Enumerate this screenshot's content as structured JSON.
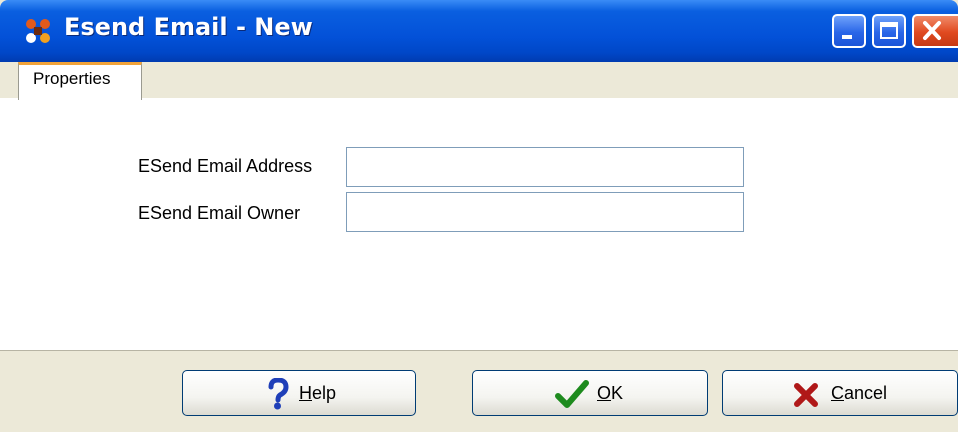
{
  "window": {
    "title": "Esend Email - New",
    "icon": "app-icon"
  },
  "tabs": [
    {
      "label": "Properties",
      "active": true
    }
  ],
  "form": {
    "address_label": "ESend Email Address",
    "address_value": "",
    "owner_label": "ESend Email Owner",
    "owner_value": ""
  },
  "buttons": {
    "help": {
      "label": "Help",
      "mnemonic": "H",
      "rest": "elp",
      "icon": "question-icon"
    },
    "ok": {
      "label": "OK",
      "mnemonic": "O",
      "rest": "K",
      "icon": "checkmark-icon"
    },
    "cancel": {
      "label": "Cancel",
      "mnemonic": "C",
      "rest": "ancel",
      "icon": "x-icon"
    }
  },
  "colors": {
    "titlebar": "#0351d8",
    "tab_accent": "#f1a33a",
    "help_icon": "#1f3fb8",
    "ok_icon": "#1e8b1e",
    "cancel_icon": "#b01818"
  }
}
